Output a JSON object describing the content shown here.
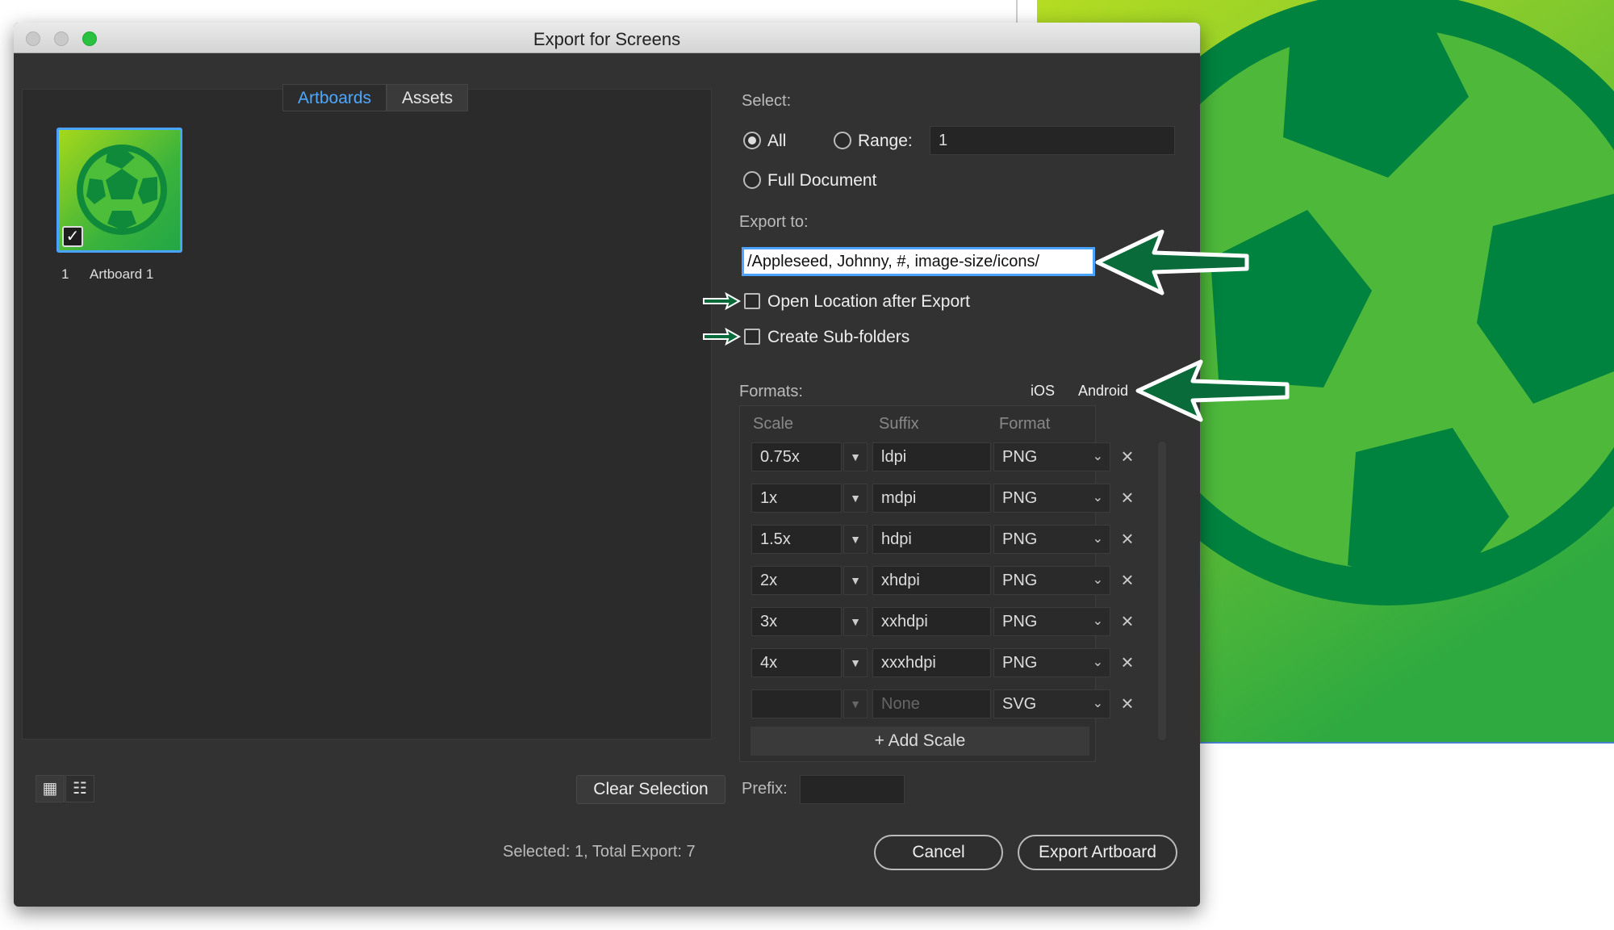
{
  "window": {
    "title": "Export for Screens"
  },
  "tabs": [
    {
      "label": "Artboards",
      "active": true
    },
    {
      "label": "Assets",
      "active": false
    }
  ],
  "artboards": [
    {
      "number": "1",
      "name": "Artboard 1",
      "checked": true
    }
  ],
  "select": {
    "label": "Select:",
    "all_label": "All",
    "range_label": "Range:",
    "range_value": "1",
    "full_document_label": "Full Document",
    "selected": "All"
  },
  "export_to": {
    "label": "Export to:",
    "path": "/Appleseed, Johnny, #, image-size/icons/",
    "open_location_label": "Open Location after Export",
    "open_location_checked": false,
    "subfolders_label": "Create Sub-folders",
    "subfolders_checked": false
  },
  "formats": {
    "label": "Formats:",
    "ios_label": "iOS",
    "android_label": "Android",
    "columns": {
      "scale": "Scale",
      "suffix": "Suffix",
      "format": "Format"
    },
    "rows": [
      {
        "scale": "0.75x",
        "suffix": "ldpi",
        "format": "PNG"
      },
      {
        "scale": "1x",
        "suffix": "mdpi",
        "format": "PNG"
      },
      {
        "scale": "1.5x",
        "suffix": "hdpi",
        "format": "PNG"
      },
      {
        "scale": "2x",
        "suffix": "xhdpi",
        "format": "PNG"
      },
      {
        "scale": "3x",
        "suffix": "xxhdpi",
        "format": "PNG"
      },
      {
        "scale": "4x",
        "suffix": "xxxhdpi",
        "format": "PNG"
      },
      {
        "scale": "",
        "suffix": "None",
        "format": "SVG"
      }
    ],
    "add_scale_label": "Add Scale",
    "remove_glyph": "×",
    "dropdown_glyph": "▼",
    "chevron_glyph": "⌄",
    "plus_glyph": "+"
  },
  "footer": {
    "clear_selection_label": "Clear Selection",
    "prefix_label": "Prefix:",
    "prefix_value": "",
    "status": "Selected: 1, Total Export: 7",
    "cancel_label": "Cancel",
    "export_label": "Export Artboard"
  },
  "colors": {
    "accent": "#4ea8ff",
    "dialog_bg": "#323232",
    "artwork_green_dark": "#00833f",
    "artwork_green_light": "#a6d81a",
    "annotation_arrow": "#0a6b3a"
  },
  "icons": {
    "grid_view": "grid-view-icon",
    "list_view": "list-view-icon",
    "check": "checkmark-icon"
  }
}
